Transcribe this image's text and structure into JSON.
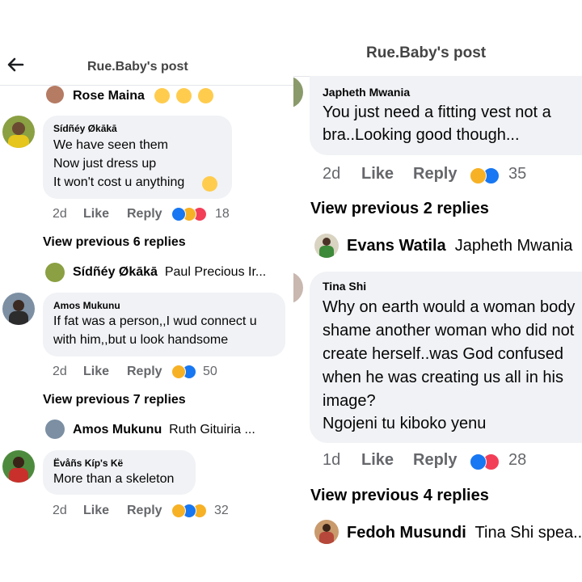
{
  "left": {
    "header": {
      "title": "Rue.Baby's post",
      "back_icon": "arrow-left-icon"
    },
    "top_reply": {
      "name": "Rose Maina",
      "emojis": [
        "laughing",
        "laughing",
        "laughing"
      ]
    },
    "comment1": {
      "author": "Sídñéy Økākā",
      "lines": [
        "We have  seen them",
        "Now just dress up",
        "It won't cost u anything"
      ],
      "emoji": "smiling",
      "time": "2d",
      "like": "Like",
      "reply": "Reply",
      "count": "18",
      "reactions": [
        "like",
        "haha",
        "love"
      ]
    },
    "view1": "View previous 6 replies",
    "reply1": {
      "name": "Sídñéy Økākā",
      "text": "Paul Precious Ir..."
    },
    "comment2": {
      "author": "Amos Mukunu",
      "lines": [
        "If fat was a person,,I wud connect u",
        "with him,,but u look handsome"
      ],
      "time": "2d",
      "like": "Like",
      "reply": "Reply",
      "count": "50",
      "reactions": [
        "haha",
        "like"
      ]
    },
    "view2": "View previous 7 replies",
    "reply2": {
      "name": "Amos Mukunu",
      "text": "Ruth Gituiria ..."
    },
    "comment3": {
      "author": "Ëvåñs Kíp's Kë",
      "lines": [
        "More than a skeleton"
      ],
      "time": "2d",
      "like": "Like",
      "reply": "Reply",
      "count": "32",
      "reactions": [
        "haha",
        "like",
        "sad"
      ]
    }
  },
  "right": {
    "header": {
      "title": "Rue.Baby's post"
    },
    "comment1": {
      "author": "Japheth Mwania",
      "lines": [
        "You just need a fitting vest not a",
        "bra..Looking good though..."
      ],
      "time": "2d",
      "like": "Like",
      "reply": "Reply",
      "count": "35",
      "reactions": [
        "haha",
        "like"
      ]
    },
    "view1": "View previous 2 replies",
    "reply1": {
      "name": "Evans Watila",
      "text": "Japheth Mwania"
    },
    "comment2": {
      "author": "Tina Shi",
      "lines": [
        "Why on earth would a woman body",
        "shame another woman who did not",
        "create herself..was God confused",
        "when he was creating us all in his",
        "image?",
        "Ngojeni tu kiboko yenu"
      ],
      "time": "1d",
      "like": "Like",
      "reply": "Reply",
      "count": "28",
      "reactions": [
        "like",
        "love"
      ]
    },
    "view2": "View previous 4 replies",
    "reply2": {
      "name": "Fedoh Musundi",
      "text": "Tina Shi spea..."
    }
  },
  "colors": {
    "like": "#1877f2",
    "love": "#f33e58",
    "haha": "#f7b125",
    "sad": "#f7b125",
    "bubble": "#f0f2f5",
    "meta": "#65676b"
  }
}
